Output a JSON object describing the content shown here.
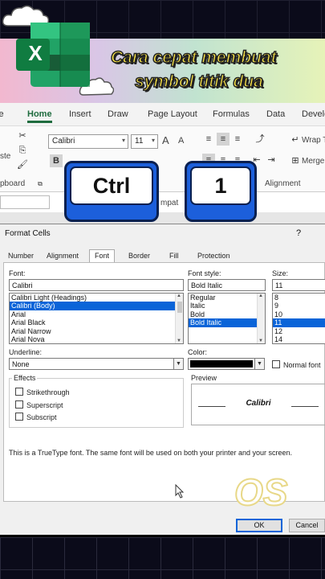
{
  "banner": {
    "title_line1": "Cara cepat membuat",
    "title_line2": "symbol titik dua",
    "app_icon_letter": "X",
    "colors": {
      "strip_left": "#f2b8cf",
      "strip_right": "#e6f3b8",
      "title_text": "#ffe94a",
      "excel_green": "#1e6b3e"
    }
  },
  "excel": {
    "tabs": [
      "le",
      "Home",
      "Insert",
      "Draw",
      "Page Layout",
      "Formulas",
      "Data",
      "Develo"
    ],
    "active_tab": "Home",
    "font_name": "Calibri",
    "font_size": "11",
    "grow_font": "A",
    "shrink_font": "A",
    "bold_icon": "B",
    "paste_partial": "ste",
    "clipboard_group": "pboard",
    "wrap_text": "Wrap T",
    "merge": "Merge",
    "alignment_group": "Alignment",
    "formula_bar_partial": "mpat"
  },
  "keys": {
    "ctrl_label": "Ctrl",
    "one_label": "1"
  },
  "dialog": {
    "title": "Format Cells",
    "help": "?",
    "tabs": [
      "Number",
      "Alignment",
      "Font",
      "Border",
      "Fill",
      "Protection"
    ],
    "active_tab": "Font",
    "font_label": "Font:",
    "font_value": "Calibri",
    "font_list": [
      "Calibri Light (Headings)",
      "Calibri (Body)",
      "Arial",
      "Arial Black",
      "Arial Narrow",
      "Arial Nova"
    ],
    "font_selected": "Calibri (Body)",
    "style_label": "Font style:",
    "style_value": "Bold Italic",
    "style_list": [
      "Regular",
      "Italic",
      "Bold",
      "Bold Italic"
    ],
    "style_selected": "Bold Italic",
    "size_label": "Size:",
    "size_value": "11",
    "size_list": [
      "8",
      "9",
      "10",
      "11",
      "12",
      "14"
    ],
    "size_selected": "11",
    "underline_label": "Underline:",
    "underline_value": "None",
    "color_label": "Color:",
    "color_value": "#000000",
    "normal_font_label": "Normal font",
    "effects_label": "Effects",
    "strikethrough_label": "Strikethrough",
    "superscript_label": "Superscript",
    "subscript_label": "Subscript",
    "preview_label": "Preview",
    "preview_text": "Calibri",
    "info_text": "This is a TrueType font.  The same font will be used on both your printer and your screen.",
    "ok_label": "OK",
    "cancel_label": "Cancel"
  },
  "watermark": "OS"
}
